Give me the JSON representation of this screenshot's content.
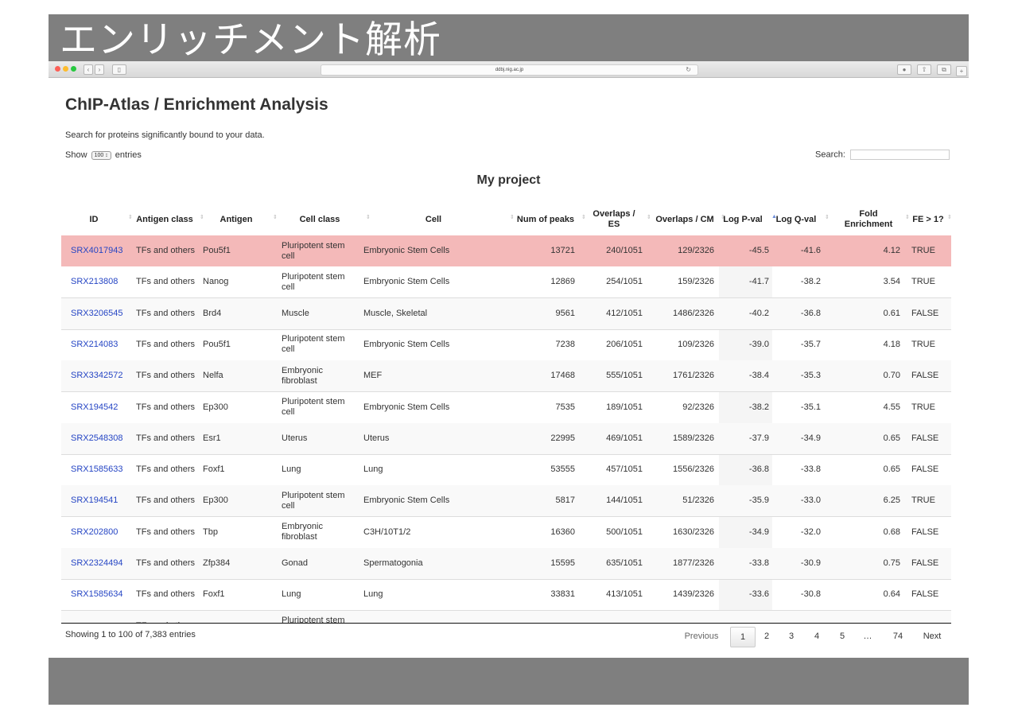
{
  "slide": {
    "title": "エンリッチメント解析"
  },
  "browser": {
    "url": "ddbj.nig.ac.jp"
  },
  "page": {
    "heading": "ChIP-Atlas / Enrichment Analysis",
    "subtext": "Search for proteins significantly bound to your data.",
    "length": {
      "show": "Show",
      "value": "100",
      "entries": "entries"
    },
    "search_label": "Search:",
    "caption": "My project"
  },
  "table": {
    "columns": [
      "ID",
      "Antigen class",
      "Antigen",
      "Cell class",
      "Cell",
      "Num of peaks",
      "Overlaps / ES",
      "Overlaps / CM",
      "Log P-val",
      "Log Q-val",
      "Fold Enrichment",
      "FE > 1?"
    ],
    "rows": [
      [
        "SRX4017943",
        "TFs and others",
        "Pou5f1",
        "Pluripotent stem cell",
        "Embryonic Stem Cells",
        "13721",
        "240/1051",
        "129/2326",
        "-45.5",
        "-41.6",
        "4.12",
        "TRUE"
      ],
      [
        "SRX213808",
        "TFs and others",
        "Nanog",
        "Pluripotent stem cell",
        "Embryonic Stem Cells",
        "12869",
        "254/1051",
        "159/2326",
        "-41.7",
        "-38.2",
        "3.54",
        "TRUE"
      ],
      [
        "SRX3206545",
        "TFs and others",
        "Brd4",
        "Muscle",
        "Muscle, Skeletal",
        "9561",
        "412/1051",
        "1486/2326",
        "-40.2",
        "-36.8",
        "0.61",
        "FALSE"
      ],
      [
        "SRX214083",
        "TFs and others",
        "Pou5f1",
        "Pluripotent stem cell",
        "Embryonic Stem Cells",
        "7238",
        "206/1051",
        "109/2326",
        "-39.0",
        "-35.7",
        "4.18",
        "TRUE"
      ],
      [
        "SRX3342572",
        "TFs and others",
        "Nelfa",
        "Embryonic fibroblast",
        "MEF",
        "17468",
        "555/1051",
        "1761/2326",
        "-38.4",
        "-35.3",
        "0.70",
        "FALSE"
      ],
      [
        "SRX194542",
        "TFs and others",
        "Ep300",
        "Pluripotent stem cell",
        "Embryonic Stem Cells",
        "7535",
        "189/1051",
        "92/2326",
        "-38.2",
        "-35.1",
        "4.55",
        "TRUE"
      ],
      [
        "SRX2548308",
        "TFs and others",
        "Esr1",
        "Uterus",
        "Uterus",
        "22995",
        "469/1051",
        "1589/2326",
        "-37.9",
        "-34.9",
        "0.65",
        "FALSE"
      ],
      [
        "SRX1585633",
        "TFs and others",
        "Foxf1",
        "Lung",
        "Lung",
        "53555",
        "457/1051",
        "1556/2326",
        "-36.8",
        "-33.8",
        "0.65",
        "FALSE"
      ],
      [
        "SRX194541",
        "TFs and others",
        "Ep300",
        "Pluripotent stem cell",
        "Embryonic Stem Cells",
        "5817",
        "144/1051",
        "51/2326",
        "-35.9",
        "-33.0",
        "6.25",
        "TRUE"
      ],
      [
        "SRX202800",
        "TFs and others",
        "Tbp",
        "Embryonic fibroblast",
        "C3H/10T1/2",
        "16360",
        "500/1051",
        "1630/2326",
        "-34.9",
        "-32.0",
        "0.68",
        "FALSE"
      ],
      [
        "SRX2324494",
        "TFs and others",
        "Zfp384",
        "Gonad",
        "Spermatogonia",
        "15595",
        "635/1051",
        "1877/2326",
        "-33.8",
        "-30.9",
        "0.75",
        "FALSE"
      ],
      [
        "SRX1585634",
        "TFs and others",
        "Foxf1",
        "Lung",
        "Lung",
        "33831",
        "413/1051",
        "1439/2326",
        "-33.6",
        "-30.8",
        "0.64",
        "FALSE"
      ],
      [
        "",
        "TFs and others",
        "",
        "Pluripotent stem cell",
        "",
        "",
        "",
        "",
        "",
        "",
        "",
        ""
      ]
    ],
    "highlighted_row": 0,
    "sorted_column": "Log P-val"
  },
  "footer": {
    "info": "Showing 1 to 100 of 7,383 entries",
    "pagination": [
      "Previous",
      "1",
      "2",
      "3",
      "4",
      "5",
      "…",
      "74",
      "Next"
    ],
    "current_page": "1"
  },
  "colors": {
    "slide_bg": "#7f7f7f",
    "link": "#2545c4",
    "highlight": "#f4b9b9"
  },
  "icons": [
    "close-dot-icon",
    "minimize-dot-icon",
    "zoom-dot-icon",
    "back-icon",
    "forward-icon",
    "sidebar-icon",
    "reload-icon",
    "download-icon",
    "share-icon",
    "tabs-icon",
    "new-tab-icon",
    "sort-icon"
  ]
}
